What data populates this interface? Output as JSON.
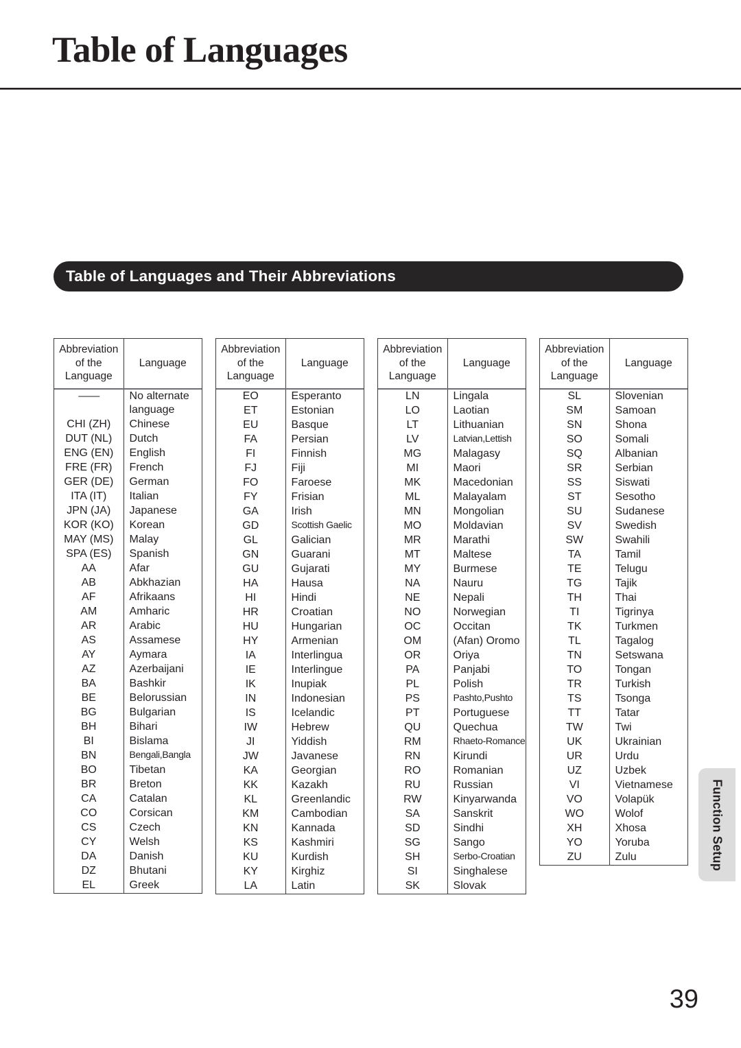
{
  "page": {
    "title": "Table of Languages",
    "number": "39"
  },
  "section": {
    "heading": "Table of Languages and Their Abbreviations"
  },
  "side_tab": {
    "label": "Function Setup",
    "color": "#dcdcdc"
  },
  "table_headers": {
    "abbreviation": "Abbreviation\nof the\nLanguage",
    "abbreviation_line1": "Abbreviation",
    "abbreviation_line2": "of the",
    "abbreviation_line3": "Language",
    "language": "Language"
  },
  "colors": {
    "text": "#231f20",
    "banner_bg": "#272425",
    "banner_text": "#ffffff",
    "table_border": "#3a3a3c",
    "header_rule": "#6e6e72"
  },
  "columns": [
    {
      "rows": [
        {
          "abbr": "——",
          "lang": "No alternate language",
          "wrap": true
        },
        {
          "abbr": "CHI (ZH)",
          "lang": "Chinese"
        },
        {
          "abbr": "DUT (NL)",
          "lang": "Dutch"
        },
        {
          "abbr": "ENG (EN)",
          "lang": "English"
        },
        {
          "abbr": "FRE (FR)",
          "lang": "French"
        },
        {
          "abbr": "GER (DE)",
          "lang": "German"
        },
        {
          "abbr": "ITA (IT)",
          "lang": "Italian"
        },
        {
          "abbr": "JPN (JA)",
          "lang": "Japanese"
        },
        {
          "abbr": "KOR (KO)",
          "lang": "Korean"
        },
        {
          "abbr": "MAY (MS)",
          "lang": "Malay"
        },
        {
          "abbr": "SPA (ES)",
          "lang": "Spanish"
        },
        {
          "abbr": "AA",
          "lang": "Afar"
        },
        {
          "abbr": "AB",
          "lang": "Abkhazian"
        },
        {
          "abbr": "AF",
          "lang": "Afrikaans"
        },
        {
          "abbr": "AM",
          "lang": "Amharic"
        },
        {
          "abbr": "AR",
          "lang": "Arabic"
        },
        {
          "abbr": "AS",
          "lang": "Assamese"
        },
        {
          "abbr": "AY",
          "lang": "Aymara"
        },
        {
          "abbr": "AZ",
          "lang": "Azerbaijani"
        },
        {
          "abbr": "BA",
          "lang": "Bashkir"
        },
        {
          "abbr": "BE",
          "lang": "Belorussian"
        },
        {
          "abbr": "BG",
          "lang": "Bulgarian"
        },
        {
          "abbr": "BH",
          "lang": "Bihari"
        },
        {
          "abbr": "BI",
          "lang": "Bislama"
        },
        {
          "abbr": "BN",
          "lang": "Bengali,Bangla",
          "squeeze": true
        },
        {
          "abbr": "BO",
          "lang": "Tibetan"
        },
        {
          "abbr": "BR",
          "lang": "Breton"
        },
        {
          "abbr": "CA",
          "lang": "Catalan"
        },
        {
          "abbr": "CO",
          "lang": "Corsican"
        },
        {
          "abbr": "CS",
          "lang": "Czech"
        },
        {
          "abbr": "CY",
          "lang": "Welsh"
        },
        {
          "abbr": "DA",
          "lang": "Danish"
        },
        {
          "abbr": "DZ",
          "lang": "Bhutani"
        },
        {
          "abbr": "EL",
          "lang": "Greek"
        }
      ]
    },
    {
      "rows": [
        {
          "abbr": "EO",
          "lang": "Esperanto"
        },
        {
          "abbr": "ET",
          "lang": "Estonian"
        },
        {
          "abbr": "EU",
          "lang": "Basque"
        },
        {
          "abbr": "FA",
          "lang": "Persian"
        },
        {
          "abbr": "FI",
          "lang": "Finnish"
        },
        {
          "abbr": "FJ",
          "lang": "Fiji"
        },
        {
          "abbr": "FO",
          "lang": "Faroese"
        },
        {
          "abbr": "FY",
          "lang": "Frisian"
        },
        {
          "abbr": "GA",
          "lang": "Irish"
        },
        {
          "abbr": "GD",
          "lang": "Scottish Gaelic",
          "squeeze": true
        },
        {
          "abbr": "GL",
          "lang": "Galician"
        },
        {
          "abbr": "GN",
          "lang": "Guarani"
        },
        {
          "abbr": "GU",
          "lang": "Gujarati"
        },
        {
          "abbr": "HA",
          "lang": "Hausa"
        },
        {
          "abbr": "HI",
          "lang": "Hindi"
        },
        {
          "abbr": "HR",
          "lang": "Croatian"
        },
        {
          "abbr": "HU",
          "lang": "Hungarian"
        },
        {
          "abbr": "HY",
          "lang": "Armenian"
        },
        {
          "abbr": "IA",
          "lang": "Interlingua"
        },
        {
          "abbr": "IE",
          "lang": "Interlingue"
        },
        {
          "abbr": "IK",
          "lang": "Inupiak"
        },
        {
          "abbr": "IN",
          "lang": "Indonesian"
        },
        {
          "abbr": "IS",
          "lang": "Icelandic"
        },
        {
          "abbr": "IW",
          "lang": "Hebrew"
        },
        {
          "abbr": "JI",
          "lang": "Yiddish"
        },
        {
          "abbr": "JW",
          "lang": "Javanese"
        },
        {
          "abbr": "KA",
          "lang": "Georgian"
        },
        {
          "abbr": "KK",
          "lang": "Kazakh"
        },
        {
          "abbr": "KL",
          "lang": "Greenlandic"
        },
        {
          "abbr": "KM",
          "lang": "Cambodian"
        },
        {
          "abbr": "KN",
          "lang": "Kannada"
        },
        {
          "abbr": "KS",
          "lang": "Kashmiri"
        },
        {
          "abbr": "KU",
          "lang": "Kurdish"
        },
        {
          "abbr": "KY",
          "lang": "Kirghiz"
        },
        {
          "abbr": "LA",
          "lang": "Latin"
        }
      ]
    },
    {
      "rows": [
        {
          "abbr": "LN",
          "lang": "Lingala"
        },
        {
          "abbr": "LO",
          "lang": "Laotian"
        },
        {
          "abbr": "LT",
          "lang": "Lithuanian"
        },
        {
          "abbr": "LV",
          "lang": "Latvian,Lettish",
          "squeeze": true
        },
        {
          "abbr": "MG",
          "lang": "Malagasy"
        },
        {
          "abbr": "MI",
          "lang": "Maori"
        },
        {
          "abbr": "MK",
          "lang": "Macedonian"
        },
        {
          "abbr": "ML",
          "lang": "Malayalam"
        },
        {
          "abbr": "MN",
          "lang": "Mongolian"
        },
        {
          "abbr": "MO",
          "lang": "Moldavian"
        },
        {
          "abbr": "MR",
          "lang": "Marathi"
        },
        {
          "abbr": "MT",
          "lang": "Maltese"
        },
        {
          "abbr": "MY",
          "lang": "Burmese"
        },
        {
          "abbr": "NA",
          "lang": "Nauru"
        },
        {
          "abbr": "NE",
          "lang": "Nepali"
        },
        {
          "abbr": "NO",
          "lang": "Norwegian"
        },
        {
          "abbr": "OC",
          "lang": "Occitan"
        },
        {
          "abbr": "OM",
          "lang": "(Afan) Oromo"
        },
        {
          "abbr": "OR",
          "lang": "Oriya"
        },
        {
          "abbr": "PA",
          "lang": "Panjabi"
        },
        {
          "abbr": "PL",
          "lang": "Polish"
        },
        {
          "abbr": "PS",
          "lang": "Pashto,Pushto",
          "squeeze": true
        },
        {
          "abbr": "PT",
          "lang": "Portuguese"
        },
        {
          "abbr": "QU",
          "lang": "Quechua"
        },
        {
          "abbr": "RM",
          "lang": "Rhaeto-Romance",
          "squeeze": true
        },
        {
          "abbr": "RN",
          "lang": "Kirundi"
        },
        {
          "abbr": "RO",
          "lang": "Romanian"
        },
        {
          "abbr": "RU",
          "lang": "Russian"
        },
        {
          "abbr": "RW",
          "lang": "Kinyarwanda"
        },
        {
          "abbr": "SA",
          "lang": "Sanskrit"
        },
        {
          "abbr": "SD",
          "lang": "Sindhi"
        },
        {
          "abbr": "SG",
          "lang": "Sango"
        },
        {
          "abbr": "SH",
          "lang": "Serbo-Croatian",
          "squeeze": true
        },
        {
          "abbr": "SI",
          "lang": "Singhalese"
        },
        {
          "abbr": "SK",
          "lang": "Slovak"
        }
      ]
    },
    {
      "rows": [
        {
          "abbr": "SL",
          "lang": "Slovenian"
        },
        {
          "abbr": "SM",
          "lang": "Samoan"
        },
        {
          "abbr": "SN",
          "lang": "Shona"
        },
        {
          "abbr": "SO",
          "lang": "Somali"
        },
        {
          "abbr": "SQ",
          "lang": "Albanian"
        },
        {
          "abbr": "SR",
          "lang": "Serbian"
        },
        {
          "abbr": "SS",
          "lang": "Siswati"
        },
        {
          "abbr": "ST",
          "lang": "Sesotho"
        },
        {
          "abbr": "SU",
          "lang": "Sudanese"
        },
        {
          "abbr": "SV",
          "lang": "Swedish"
        },
        {
          "abbr": "SW",
          "lang": "Swahili"
        },
        {
          "abbr": "TA",
          "lang": "Tamil"
        },
        {
          "abbr": "TE",
          "lang": "Telugu"
        },
        {
          "abbr": "TG",
          "lang": "Tajik"
        },
        {
          "abbr": "TH",
          "lang": "Thai"
        },
        {
          "abbr": "TI",
          "lang": "Tigrinya"
        },
        {
          "abbr": "TK",
          "lang": "Turkmen"
        },
        {
          "abbr": "TL",
          "lang": "Tagalog"
        },
        {
          "abbr": "TN",
          "lang": "Setswana"
        },
        {
          "abbr": "TO",
          "lang": "Tongan"
        },
        {
          "abbr": "TR",
          "lang": "Turkish"
        },
        {
          "abbr": "TS",
          "lang": "Tsonga"
        },
        {
          "abbr": "TT",
          "lang": "Tatar"
        },
        {
          "abbr": "TW",
          "lang": "Twi"
        },
        {
          "abbr": "UK",
          "lang": "Ukrainian"
        },
        {
          "abbr": "UR",
          "lang": "Urdu"
        },
        {
          "abbr": "UZ",
          "lang": "Uzbek"
        },
        {
          "abbr": "VI",
          "lang": "Vietnamese"
        },
        {
          "abbr": "VO",
          "lang": "Volapük"
        },
        {
          "abbr": "WO",
          "lang": "Wolof"
        },
        {
          "abbr": "XH",
          "lang": "Xhosa"
        },
        {
          "abbr": "YO",
          "lang": "Yoruba"
        },
        {
          "abbr": "ZU",
          "lang": "Zulu"
        }
      ]
    }
  ]
}
